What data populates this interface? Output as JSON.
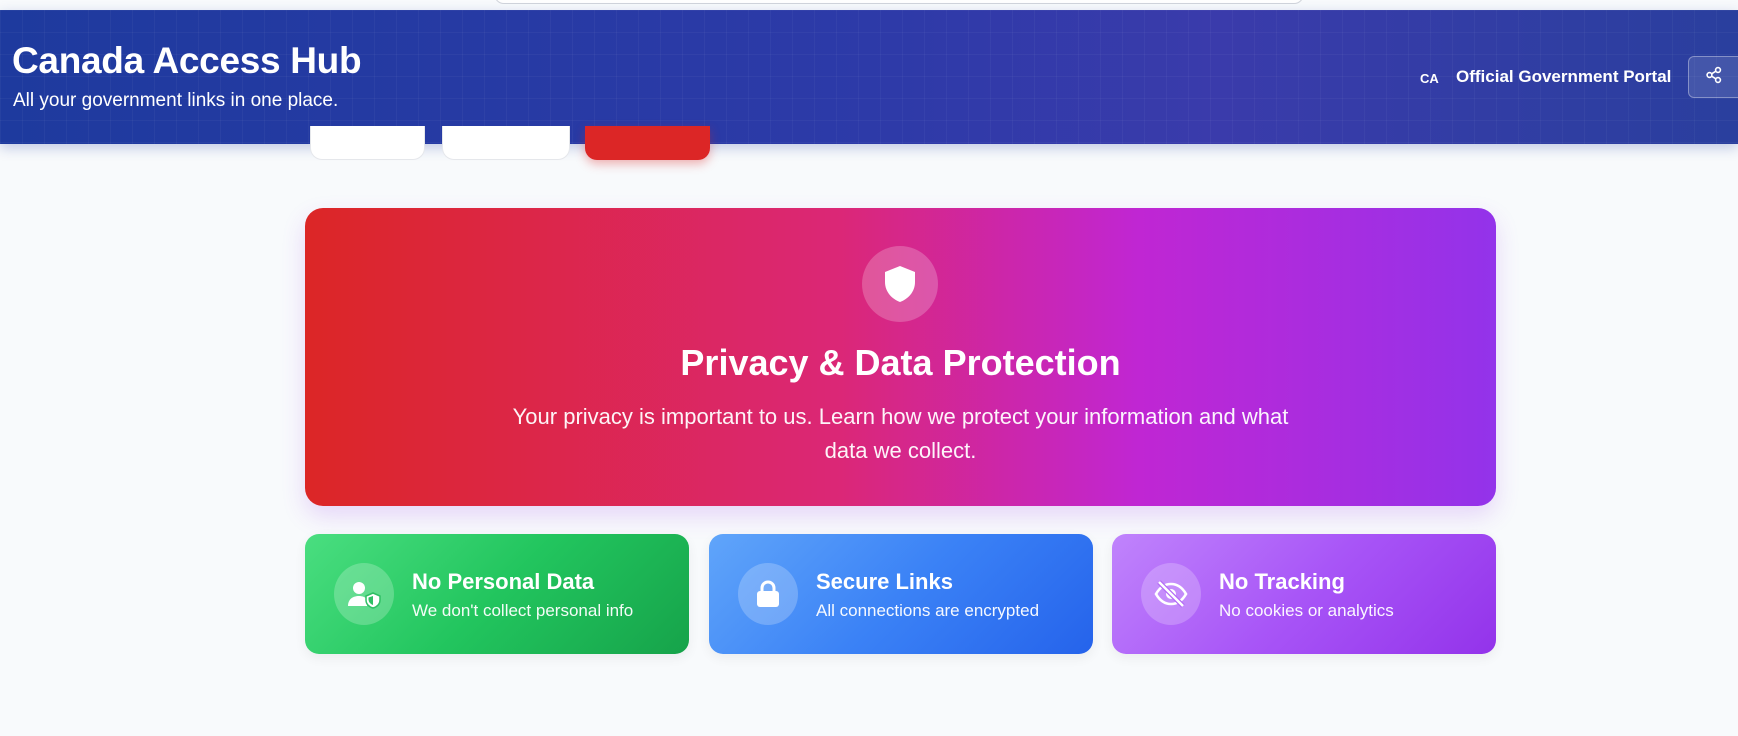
{
  "header": {
    "title": "Canada Access Hub",
    "tagline": "All your government links in one place.",
    "country_code": "CA",
    "portal_label": "Official Government Portal",
    "share_icon": "share-icon"
  },
  "hero": {
    "icon": "shield-icon",
    "title": "Privacy & Data Protection",
    "description": "Your privacy is important to us. Learn how we protect your information and what data we collect."
  },
  "features": [
    {
      "icon": "user-shield-icon",
      "title": "No Personal Data",
      "description": "We don't collect personal info",
      "color": "#22c55e"
    },
    {
      "icon": "lock-icon",
      "title": "Secure Links",
      "description": "All connections are encrypted",
      "color": "#3b82f6"
    },
    {
      "icon": "eye-slash-icon",
      "title": "No Tracking",
      "description": "No cookies or analytics",
      "color": "#a855f7"
    }
  ],
  "colors": {
    "header_start": "#1e3a9e",
    "hero_start": "#dc2626",
    "hero_end": "#9333ea",
    "active_tab": "#dc2626",
    "page_background": "#f8fafc"
  }
}
